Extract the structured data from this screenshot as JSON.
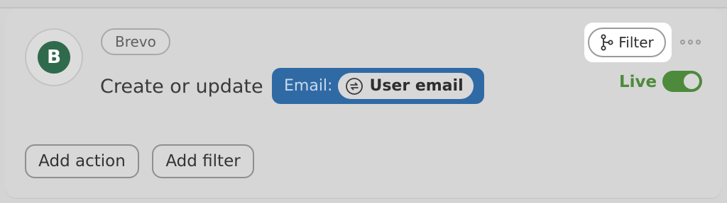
{
  "card": {
    "avatar_letter": "B",
    "app_name": "Brevo",
    "action_text": "Create or update",
    "email_field": {
      "label": "Email:",
      "value_chip": "User email",
      "value_icon": "sync-icon"
    }
  },
  "header_actions": {
    "filter_label": "Filter",
    "filter_icon": "branch-filter-icon",
    "more_icon": "more-dots-icon"
  },
  "status": {
    "label": "Live",
    "toggle_on": true
  },
  "footer": {
    "add_action_label": "Add action",
    "add_filter_label": "Add filter"
  },
  "colors": {
    "accent_green": "#4d8a3c",
    "email_pill_blue": "#2f6aa5",
    "brand_green": "#2f6a4c"
  }
}
